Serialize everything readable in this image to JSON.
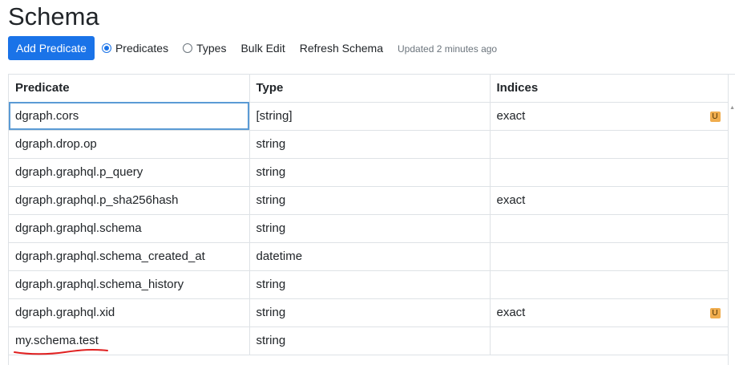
{
  "page": {
    "title": "Schema"
  },
  "toolbar": {
    "add_predicate_label": "Add Predicate",
    "view_options": [
      {
        "label": "Predicates",
        "checked": true
      },
      {
        "label": "Types",
        "checked": false
      }
    ],
    "bulk_edit_label": "Bulk Edit",
    "refresh_label": "Refresh Schema",
    "updated_text": "Updated 2 minutes ago"
  },
  "table": {
    "headers": [
      "Predicate",
      "Type",
      "Indices"
    ],
    "rows": [
      {
        "predicate": "dgraph.cors",
        "type": "[string]",
        "indices": "exact",
        "badge": "U"
      },
      {
        "predicate": "dgraph.drop.op",
        "type": "string",
        "indices": "",
        "badge": ""
      },
      {
        "predicate": "dgraph.graphql.p_query",
        "type": "string",
        "indices": "",
        "badge": ""
      },
      {
        "predicate": "dgraph.graphql.p_sha256hash",
        "type": "string",
        "indices": "exact",
        "badge": ""
      },
      {
        "predicate": "dgraph.graphql.schema",
        "type": "string",
        "indices": "",
        "badge": ""
      },
      {
        "predicate": "dgraph.graphql.schema_created_at",
        "type": "datetime",
        "indices": "",
        "badge": ""
      },
      {
        "predicate": "dgraph.graphql.schema_history",
        "type": "string",
        "indices": "",
        "badge": ""
      },
      {
        "predicate": "dgraph.graphql.xid",
        "type": "string",
        "indices": "exact",
        "badge": "U"
      },
      {
        "predicate": "my.schema.test",
        "type": "string",
        "indices": "",
        "badge": ""
      }
    ]
  },
  "colors": {
    "primary": "#1a73e8",
    "badge": "#f0ad4e",
    "annotation": "#e02020"
  },
  "icons": {
    "scroll_up": "triangle-up-icon"
  }
}
